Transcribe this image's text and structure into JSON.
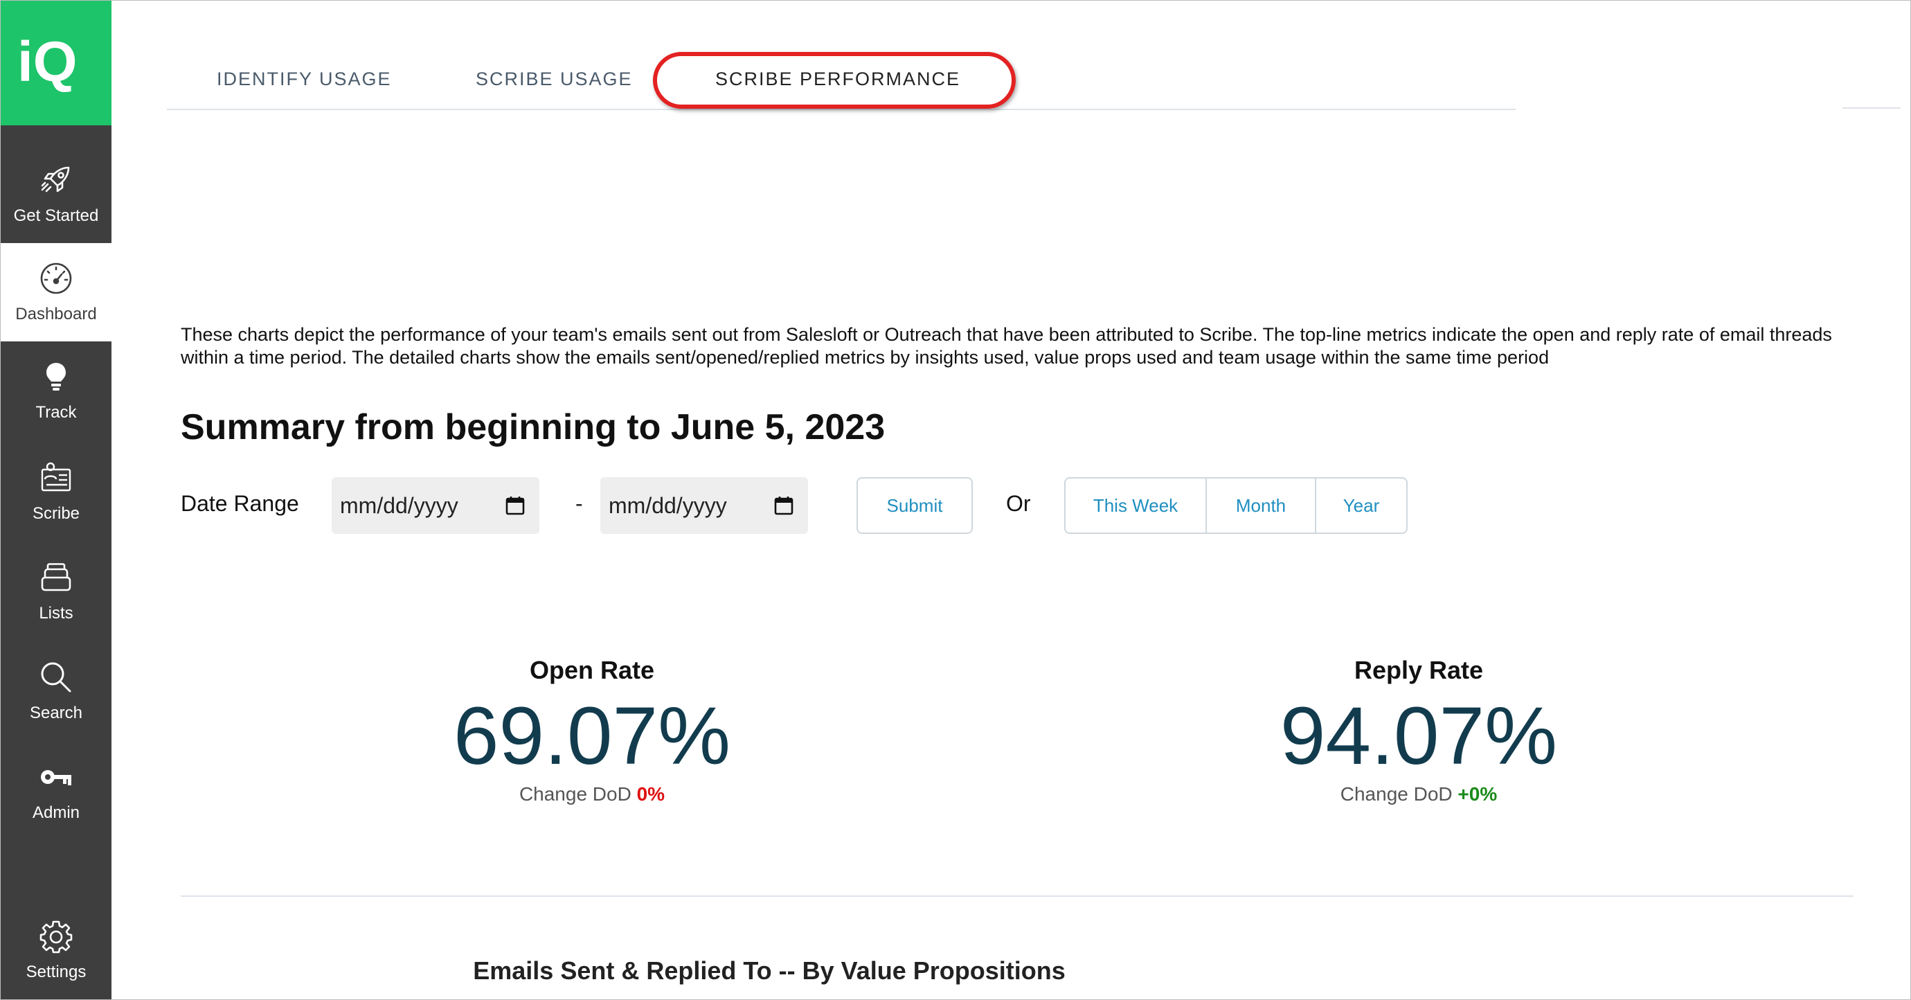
{
  "colors": {
    "sidebar_bg": "#3e3e3e",
    "logo_bg": "#1ec46a",
    "accent_blue": "#1f8fc0",
    "metric_value": "#123c4e",
    "highlight_red": "#e32222",
    "negative": "#e01010",
    "positive": "#1a8a1a"
  },
  "sidebar": {
    "logo": "iQ",
    "items": [
      {
        "label": "Get Started",
        "icon": "rocket-icon",
        "active": false
      },
      {
        "label": "Dashboard",
        "icon": "dashboard-gauge-icon",
        "active": true
      },
      {
        "label": "Track",
        "icon": "lightbulb-icon",
        "active": false
      },
      {
        "label": "Scribe",
        "icon": "scribe-icon",
        "active": false
      },
      {
        "label": "Lists",
        "icon": "stack-icon",
        "active": false
      },
      {
        "label": "Search",
        "icon": "search-icon",
        "active": false
      },
      {
        "label": "Admin",
        "icon": "key-icon",
        "active": false
      },
      {
        "label": "Settings",
        "icon": "gear-icon",
        "active": false
      }
    ]
  },
  "tabs": [
    {
      "label": "IDENTIFY USAGE",
      "active": false
    },
    {
      "label": "SCRIBE USAGE",
      "active": false
    },
    {
      "label": "SCRIBE PERFORMANCE",
      "active": true
    }
  ],
  "main": {
    "description": "These charts depict the performance of your team's emails sent out from Salesloft or Outreach that have been attributed to Scribe. The top-line metrics indicate the open and reply rate of email threads within a time period. The detailed charts show the emails sent/opened/replied metrics by insights used, value props used and team usage within the same time period",
    "summary_title": "Summary from beginning to June 5, 2023",
    "date_range": {
      "label": "Date Range",
      "start_placeholder": "mm/dd/yyyy",
      "separator": "-",
      "end_placeholder": "mm/dd/yyyy",
      "submit_label": "Submit",
      "or_label": "Or",
      "quick_ranges": [
        "This Week",
        "Month",
        "Year"
      ]
    },
    "metrics": {
      "open_rate": {
        "title": "Open Rate",
        "value": "69.07%",
        "change_label": "Change DoD",
        "change_value": "0%"
      },
      "reply_rate": {
        "title": "Reply Rate",
        "value": "94.07%",
        "change_label": "Change DoD",
        "change_value": "+0%"
      }
    },
    "section_title": "Emails Sent & Replied To -- By Value Propositions"
  }
}
